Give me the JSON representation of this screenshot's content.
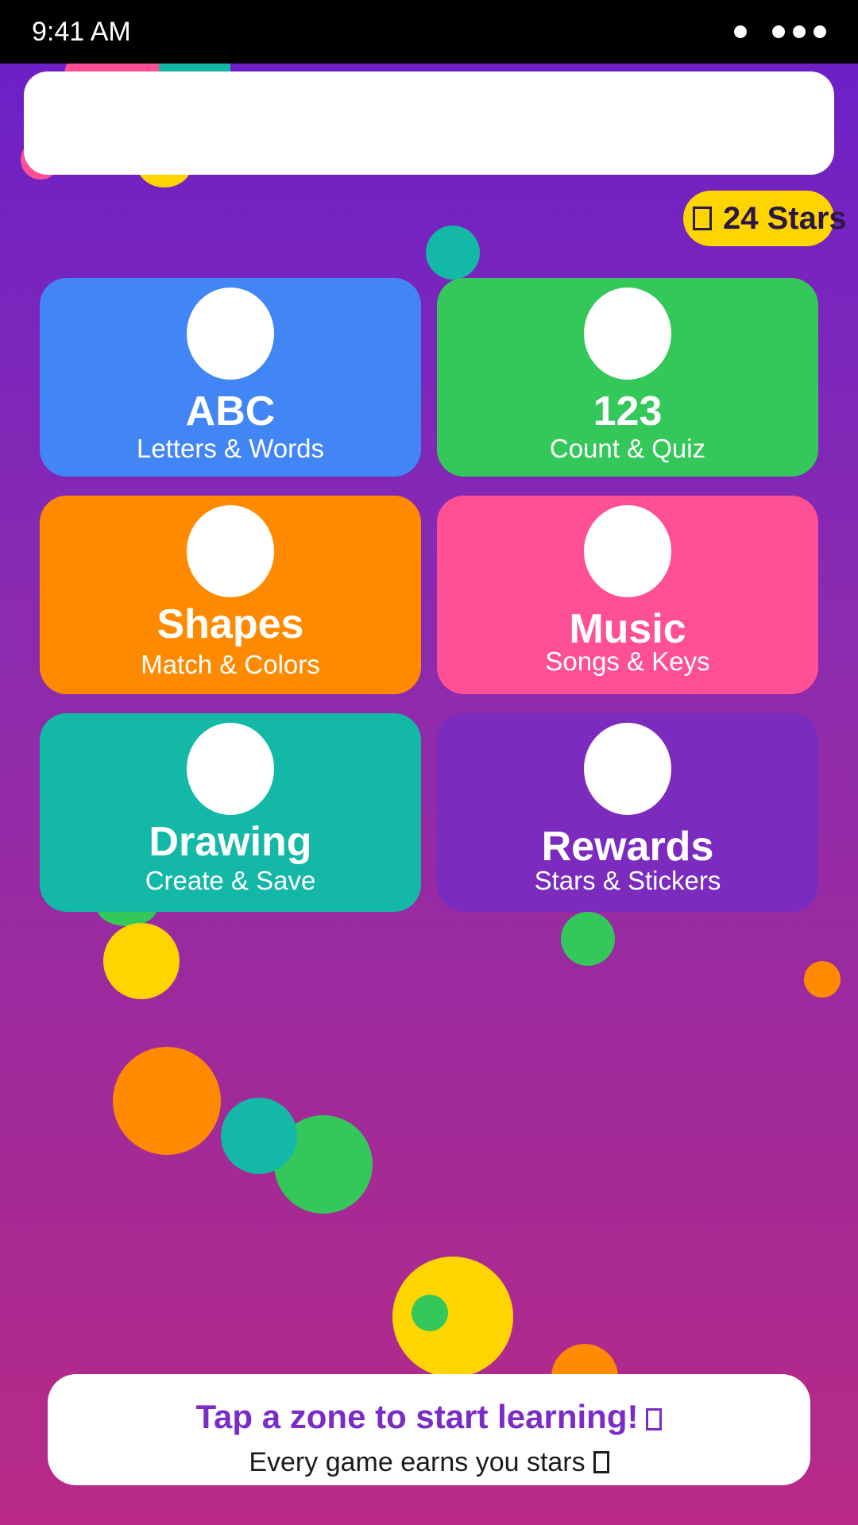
{
  "status_bar": {
    "time": "9:41 AM"
  },
  "stars_badge": {
    "count_text": "24 Stars",
    "icon": "star-icon"
  },
  "tiles": [
    {
      "title": "ABC",
      "subtitle": "Letters & Words",
      "color": "#4285F4",
      "icon": "letters-icon"
    },
    {
      "title": "123",
      "subtitle": "Count & Quiz",
      "color": "#34C759",
      "icon": "numbers-icon"
    },
    {
      "title": "Shapes",
      "subtitle": "Match & Colors",
      "color": "#FF8A00",
      "icon": "shapes-icon"
    },
    {
      "title": "Music",
      "subtitle": "Songs & Keys",
      "color": "#FF4F95",
      "icon": "music-icon"
    },
    {
      "title": "Drawing",
      "subtitle": "Create & Save",
      "color": "#14B8A6",
      "icon": "drawing-icon"
    },
    {
      "title": "Rewards",
      "subtitle": "Stars & Stickers",
      "color": "#7B2CBF",
      "icon": "rewards-icon"
    }
  ],
  "bottom_card": {
    "title": "Tap a zone to start learning!",
    "subtitle": "Every game earns you stars"
  },
  "colors": {
    "background_top": "#6A1FC9",
    "background_bottom": "#B82A86",
    "badge": "#FFD500",
    "accent_text": "#7B2CC7"
  }
}
